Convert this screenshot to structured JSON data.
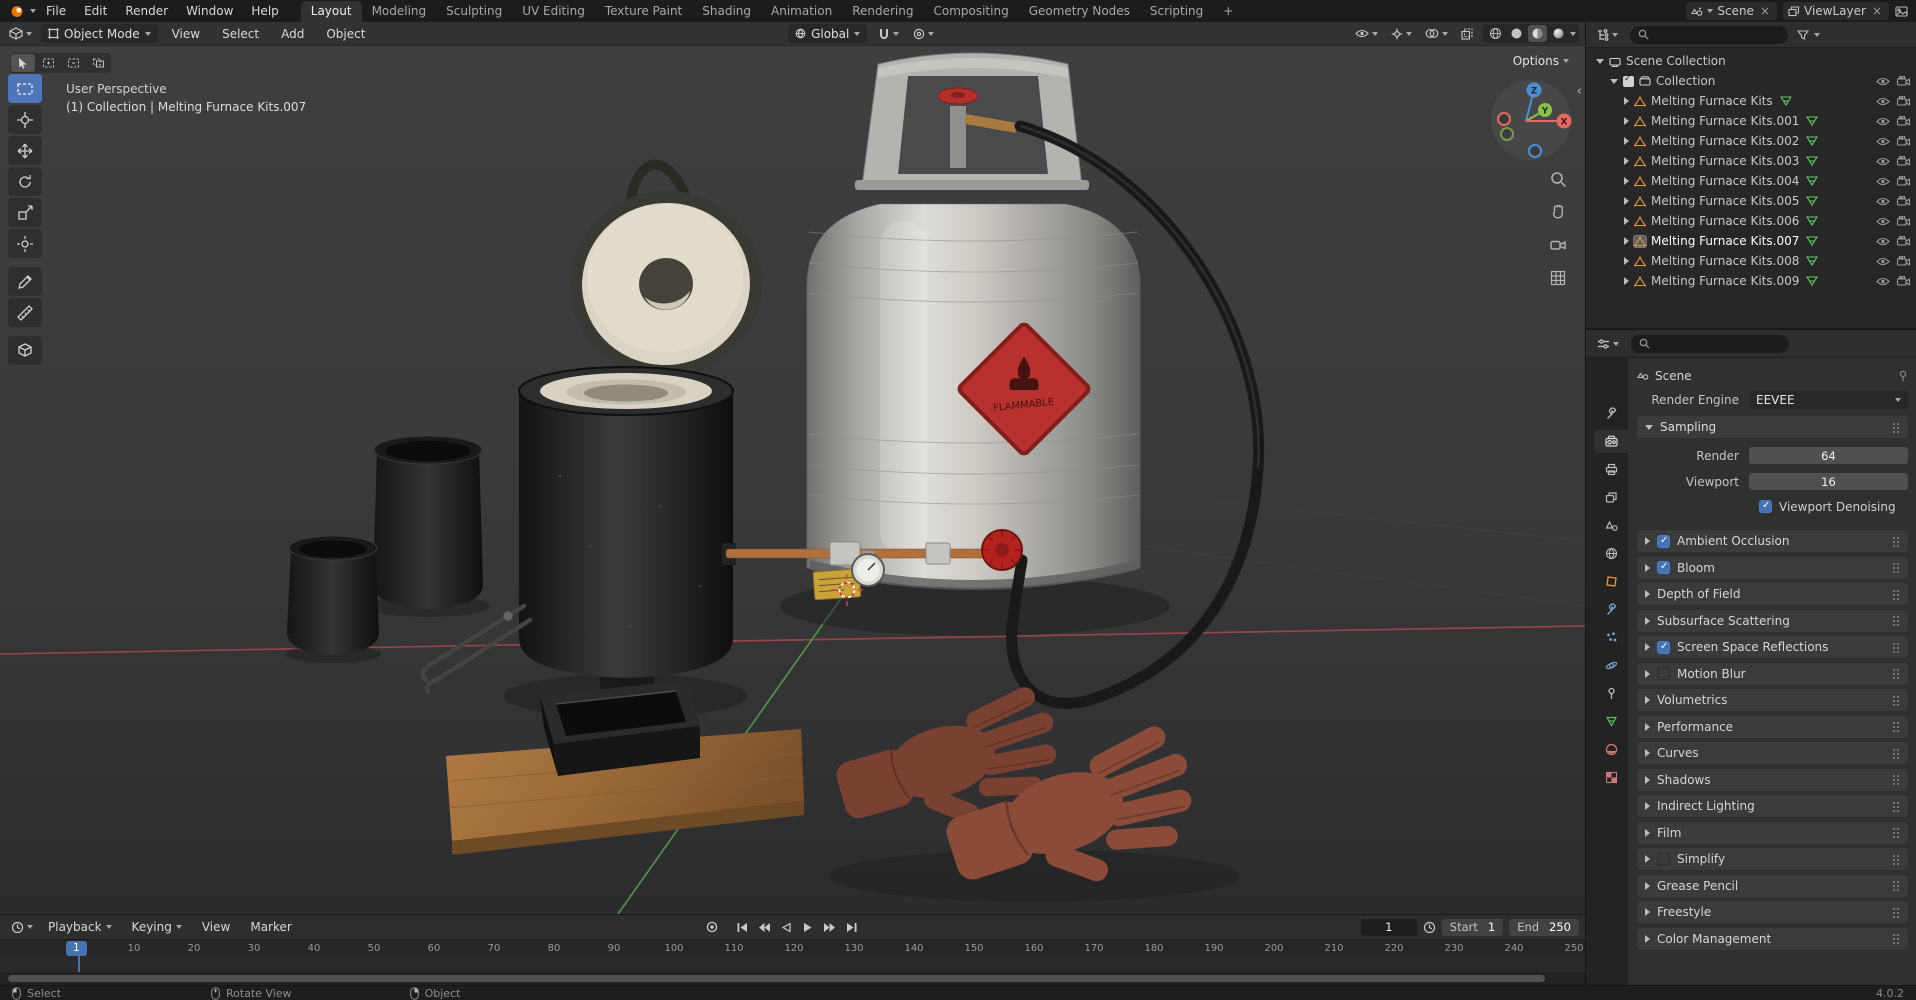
{
  "colors": {
    "accent": "#4772b3",
    "object_orange": "#e8953c",
    "mesh_green": "#63c763"
  },
  "topbar": {
    "menus": [
      "File",
      "Edit",
      "Render",
      "Window",
      "Help"
    ],
    "workspaces": [
      {
        "label": "Layout",
        "active": true
      },
      {
        "label": "Modeling"
      },
      {
        "label": "Sculpting"
      },
      {
        "label": "UV Editing"
      },
      {
        "label": "Texture Paint"
      },
      {
        "label": "Shading"
      },
      {
        "label": "Animation"
      },
      {
        "label": "Rendering"
      },
      {
        "label": "Compositing"
      },
      {
        "label": "Geometry Nodes"
      },
      {
        "label": "Scripting"
      },
      {
        "label": "+"
      }
    ],
    "scene_name": "Scene",
    "viewlayer_name": "ViewLayer"
  },
  "viewport_header": {
    "mode": "Object Mode",
    "menus": [
      "View",
      "Select",
      "Add",
      "Object"
    ],
    "orientation": "Global",
    "options_label": "Options"
  },
  "viewport": {
    "view_label": "User Perspective",
    "breadcrumb": "(1) Collection | Melting Furnace Kits.007",
    "tank_label": "FLAMMABLE",
    "gizmo": {
      "x": "X",
      "y": "Y",
      "z": "Z"
    }
  },
  "outliner": {
    "scene_collection_label": "Scene Collection",
    "collection_label": "Collection",
    "items": [
      {
        "label": "Melting Furnace Kits"
      },
      {
        "label": "Melting Furnace Kits.001"
      },
      {
        "label": "Melting Furnace Kits.002"
      },
      {
        "label": "Melting Furnace Kits.003"
      },
      {
        "label": "Melting Furnace Kits.004"
      },
      {
        "label": "Melting Furnace Kits.005"
      },
      {
        "label": "Melting Furnace Kits.006"
      },
      {
        "label": "Melting Furnace Kits.007",
        "active": true
      },
      {
        "label": "Melting Furnace Kits.008"
      },
      {
        "label": "Melting Furnace Kits.009"
      }
    ]
  },
  "properties": {
    "breadcrumb": "Scene",
    "render_engine_label": "Render Engine",
    "render_engine": "EEVEE",
    "sampling": {
      "title": "Sampling",
      "render_label": "Render",
      "render_value": "64",
      "viewport_label": "Viewport",
      "viewport_value": "16",
      "denoising_label": "Viewport Denoising",
      "denoising_checked": true
    },
    "sections": [
      {
        "label": "Ambient Occlusion",
        "checkbox": true,
        "checked": true
      },
      {
        "label": "Bloom",
        "checkbox": true,
        "checked": true
      },
      {
        "label": "Depth of Field"
      },
      {
        "label": "Subsurface Scattering"
      },
      {
        "label": "Screen Space Reflections",
        "checkbox": true,
        "checked": true
      },
      {
        "label": "Motion Blur",
        "checkbox": true
      },
      {
        "label": "Volumetrics"
      },
      {
        "label": "Performance"
      },
      {
        "label": "Curves"
      },
      {
        "label": "Shadows"
      },
      {
        "label": "Indirect Lighting"
      },
      {
        "label": "Film"
      },
      {
        "label": "Simplify",
        "checkbox": true
      },
      {
        "label": "Grease Pencil"
      },
      {
        "label": "Freestyle"
      },
      {
        "label": "Color Management"
      }
    ]
  },
  "timeline": {
    "menus": [
      {
        "label": "Playback",
        "caret": true
      },
      {
        "label": "Keying",
        "caret": true
      },
      {
        "label": "View"
      },
      {
        "label": "Marker"
      }
    ],
    "current_frame": "1",
    "start_label": "Start",
    "start_value": "1",
    "end_label": "End",
    "end_value": "250",
    "ticks": [
      "10",
      "20",
      "30",
      "40",
      "50",
      "60",
      "70",
      "80",
      "90",
      "100",
      "110",
      "120",
      "130",
      "140",
      "150",
      "160",
      "170",
      "180",
      "190",
      "200",
      "210",
      "220",
      "230",
      "240",
      "250"
    ]
  },
  "statusbar": {
    "left": "Select",
    "middle": "Rotate View",
    "right": "Object",
    "version": "4.0.2"
  }
}
